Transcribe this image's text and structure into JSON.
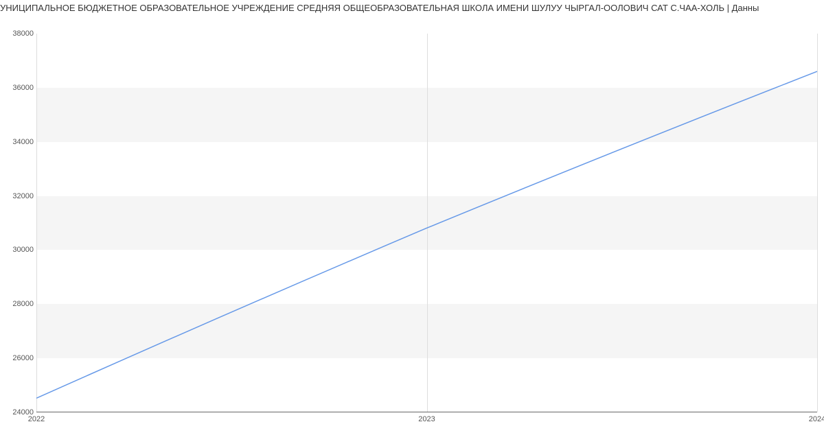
{
  "title": "УНИЦИПАЛЬНОЕ БЮДЖЕТНОЕ ОБРАЗОВАТЕЛЬНОЕ УЧРЕЖДЕНИЕ СРЕДНЯЯ ОБЩЕОБРАЗОВАТЕЛЬНАЯ ШКОЛА ИМЕНИ ШУЛУУ ЧЫРГАЛ-ООЛОВИЧ САТ С.ЧАА-ХОЛЬ | Данны",
  "chart_data": {
    "type": "line",
    "x": [
      2022,
      2023,
      2024
    ],
    "values": [
      24500,
      30800,
      36600
    ],
    "y_ticks": [
      24000,
      26000,
      28000,
      30000,
      32000,
      34000,
      36000,
      38000
    ],
    "x_ticks": [
      2022,
      2023,
      2024
    ],
    "ylim": [
      24000,
      38000
    ],
    "xlim": [
      2022,
      2024
    ],
    "title": "",
    "xlabel": "",
    "ylabel": ""
  }
}
